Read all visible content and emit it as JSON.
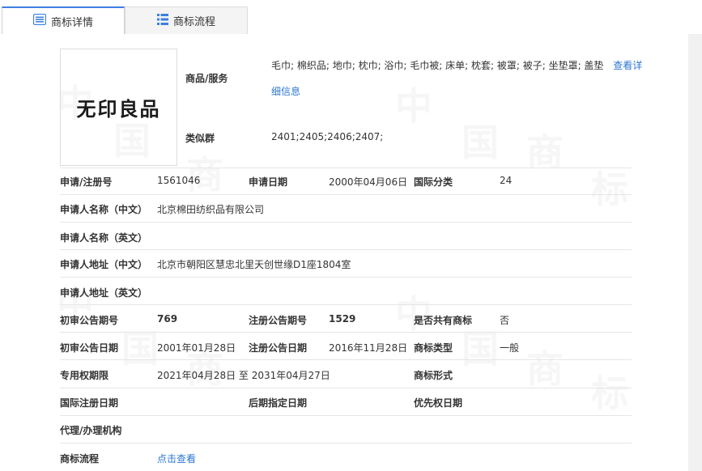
{
  "tabs": [
    {
      "label": "商标详情",
      "icon": "list-detail-icon"
    },
    {
      "label": "商标流程",
      "icon": "grid-list-icon"
    }
  ],
  "logo": {
    "text": "无印良品"
  },
  "watermark": {
    "chars": [
      "中",
      "国",
      "商",
      "标"
    ]
  },
  "goods": {
    "label": "商品/服务",
    "value": "毛巾; 棉织品; 地巾; 枕巾; 浴巾; 毛巾被; 床单; 枕套; 被罩; 被子; 坐垫罩; 盖垫",
    "more_link_1": "查看详",
    "more_link_2": "细信息"
  },
  "similar": {
    "label": "类似群",
    "value": "2401;2405;2406;2407;"
  },
  "fields": {
    "reg_no": {
      "label": "申请/注册号",
      "value": "1561046"
    },
    "app_date": {
      "label": "申请日期",
      "value": "2000年04月06日"
    },
    "intl_class": {
      "label": "国际分类",
      "value": "24"
    },
    "applicant_cn": {
      "label": "申请人名称（中文）",
      "value": "北京棉田纺织品有限公司"
    },
    "applicant_en": {
      "label": "申请人名称（英文）",
      "value": ""
    },
    "address_cn": {
      "label": "申请人地址（中文）",
      "value": "北京市朝阳区慧忠北里天创世缘D1座1804室"
    },
    "address_en": {
      "label": "申请人地址（英文）",
      "value": ""
    },
    "prelim_issue": {
      "label": "初审公告期号",
      "value": "769"
    },
    "reg_issue": {
      "label": "注册公告期号",
      "value": "1529"
    },
    "shared": {
      "label": "是否共有商标",
      "value": "否"
    },
    "prelim_date": {
      "label": "初审公告日期",
      "value": "2001年01月28日"
    },
    "reg_date": {
      "label": "注册公告日期",
      "value": "2016年11月28日"
    },
    "tm_type": {
      "label": "商标类型",
      "value": "一般"
    },
    "validity": {
      "label": "专用权期限",
      "value": "2021年04月28日 至 2031年04月27日"
    },
    "tm_form": {
      "label": "商标形式",
      "value": ""
    },
    "intl_reg_date": {
      "label": "国际注册日期",
      "value": ""
    },
    "later_date": {
      "label": "后期指定日期",
      "value": ""
    },
    "priority_date": {
      "label": "优先权日期",
      "value": ""
    },
    "agent": {
      "label": "代理/办理机构",
      "value": ""
    },
    "flow": {
      "label": "商标流程",
      "value": "点击查看"
    }
  }
}
